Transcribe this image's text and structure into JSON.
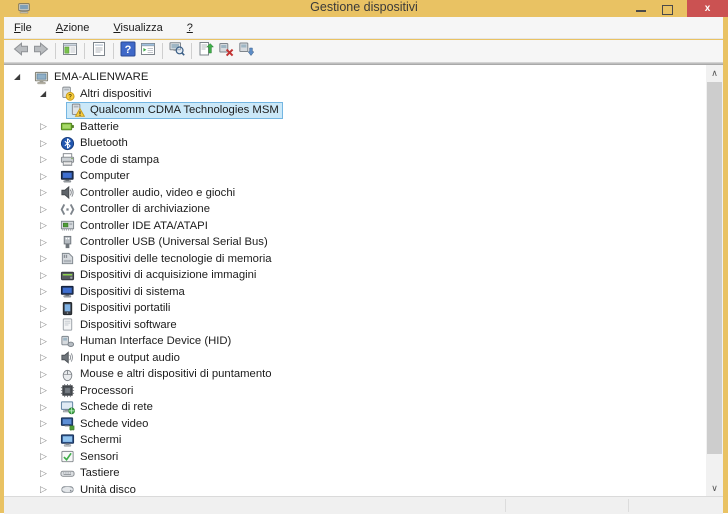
{
  "window": {
    "title": "Gestione dispositivi",
    "icon": "device-manager-icon"
  },
  "titlebar": {
    "close_glyph": "x",
    "controls": [
      "minimize-button",
      "maximize-button",
      "close-button"
    ]
  },
  "menubar": {
    "items": [
      {
        "hot": "F",
        "rest": "ile"
      },
      {
        "hot": "A",
        "rest": "zione"
      },
      {
        "hot": "V",
        "rest": "isualizza"
      },
      {
        "hot": "?",
        "rest": ""
      }
    ]
  },
  "toolbar": {
    "groups": [
      [
        "back-icon",
        "forward-icon"
      ],
      [
        "show-console-tree-icon"
      ],
      [
        "properties-icon"
      ],
      [
        "help-icon",
        "list-view-icon"
      ],
      [
        "scan-hardware-icon"
      ],
      [
        "update-driver-icon",
        "uninstall-icon",
        "disable-icon"
      ]
    ]
  },
  "tree": {
    "items": [
      {
        "label": "EMA-ALIENWARE",
        "level": 0,
        "twisty": "expanded",
        "icon": "computer-icon",
        "selected": false
      },
      {
        "label": "Altri dispositivi",
        "level": 1,
        "twisty": "expanded",
        "icon": "unknown-device-icon",
        "selected": false
      },
      {
        "label": "Qualcomm CDMA Technologies MSM",
        "level": 2,
        "twisty": "none",
        "icon": "warning-device-icon",
        "selected": true
      },
      {
        "label": "Batterie",
        "level": 1,
        "twisty": "collapsed",
        "icon": "battery-icon",
        "selected": false
      },
      {
        "label": "Bluetooth",
        "level": 1,
        "twisty": "collapsed",
        "icon": "bluetooth-icon",
        "selected": false
      },
      {
        "label": "Code di stampa",
        "level": 1,
        "twisty": "collapsed",
        "icon": "printer-icon",
        "selected": false
      },
      {
        "label": "Computer",
        "level": 1,
        "twisty": "collapsed",
        "icon": "computer-category-icon",
        "selected": false
      },
      {
        "label": "Controller audio, video e giochi",
        "level": 1,
        "twisty": "collapsed",
        "icon": "speaker-icon",
        "selected": false
      },
      {
        "label": "Controller di archiviazione",
        "level": 1,
        "twisty": "collapsed",
        "icon": "storage-controller-icon",
        "selected": false
      },
      {
        "label": "Controller IDE ATA/ATAPI",
        "level": 1,
        "twisty": "collapsed",
        "icon": "ide-controller-icon",
        "selected": false
      },
      {
        "label": "Controller USB (Universal Serial Bus)",
        "level": 1,
        "twisty": "collapsed",
        "icon": "usb-icon",
        "selected": false
      },
      {
        "label": "Dispositivi delle tecnologie di memoria",
        "level": 1,
        "twisty": "collapsed",
        "icon": "memory-card-icon",
        "selected": false
      },
      {
        "label": "Dispositivi di acquisizione immagini",
        "level": 1,
        "twisty": "collapsed",
        "icon": "imaging-device-icon",
        "selected": false
      },
      {
        "label": "Dispositivi di sistema",
        "level": 1,
        "twisty": "collapsed",
        "icon": "system-device-icon",
        "selected": false
      },
      {
        "label": "Dispositivi portatili",
        "level": 1,
        "twisty": "collapsed",
        "icon": "portable-device-icon",
        "selected": false
      },
      {
        "label": "Dispositivi software",
        "level": 1,
        "twisty": "collapsed",
        "icon": "software-device-icon",
        "selected": false
      },
      {
        "label": "Human Interface Device (HID)",
        "level": 1,
        "twisty": "collapsed",
        "icon": "hid-icon",
        "selected": false
      },
      {
        "label": "Input e output audio",
        "level": 1,
        "twisty": "collapsed",
        "icon": "audio-io-icon",
        "selected": false
      },
      {
        "label": "Mouse e altri dispositivi di puntamento",
        "level": 1,
        "twisty": "collapsed",
        "icon": "mouse-icon",
        "selected": false
      },
      {
        "label": "Processori",
        "level": 1,
        "twisty": "collapsed",
        "icon": "processor-icon",
        "selected": false
      },
      {
        "label": "Schede di rete",
        "level": 1,
        "twisty": "collapsed",
        "icon": "network-adapter-icon",
        "selected": false
      },
      {
        "label": "Schede video",
        "level": 1,
        "twisty": "collapsed",
        "icon": "video-card-icon",
        "selected": false
      },
      {
        "label": "Schermi",
        "level": 1,
        "twisty": "collapsed",
        "icon": "monitor-icon",
        "selected": false
      },
      {
        "label": "Sensori",
        "level": 1,
        "twisty": "collapsed",
        "icon": "sensor-icon",
        "selected": false
      },
      {
        "label": "Tastiere",
        "level": 1,
        "twisty": "collapsed",
        "icon": "keyboard-icon",
        "selected": false
      },
      {
        "label": "Unità disco",
        "level": 1,
        "twisty": "collapsed",
        "icon": "disk-drive-icon",
        "selected": false
      }
    ]
  },
  "scrollbar": {
    "up": "chevron-up-icon",
    "down": "chevron-down-icon"
  },
  "colors": {
    "frame": "#e9c263",
    "close_button": "#cb5252",
    "selection_bg": "#cbe8f8",
    "selection_border": "#74b6e2"
  }
}
